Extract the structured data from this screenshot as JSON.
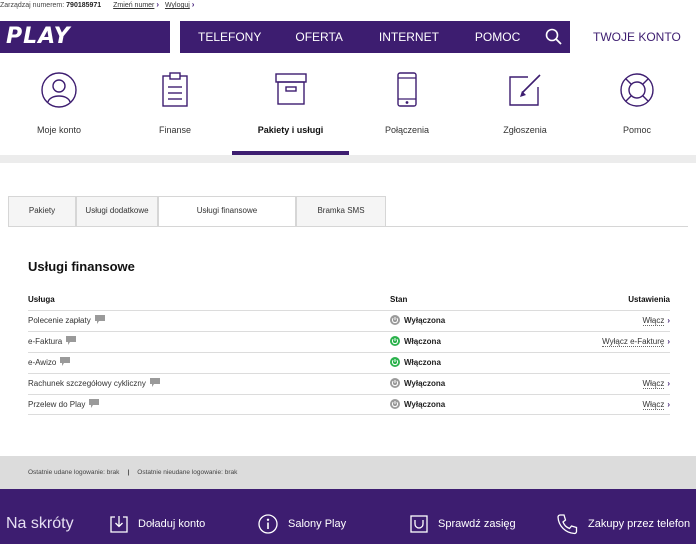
{
  "topbar": {
    "managing_label": "Zarządzaj numerem:",
    "number": "790185971",
    "change_number": "Zmień numer",
    "logout": "Wyloguj"
  },
  "header": {
    "logo": "PLAY",
    "nav": [
      "TELEFONY",
      "OFERTA",
      "INTERNET",
      "POMOC"
    ],
    "search_icon": "search-icon",
    "account_tab": "TWOJE KONTO"
  },
  "iconstrip": {
    "items": [
      {
        "label": "Moje konto",
        "icon": "user-icon",
        "active": false
      },
      {
        "label": "Finanse",
        "icon": "clipboard-icon",
        "active": false
      },
      {
        "label": "Pakiety i usługi",
        "icon": "box-icon",
        "active": true
      },
      {
        "label": "Połączenia",
        "icon": "phone-icon",
        "active": false
      },
      {
        "label": "Zgłoszenia",
        "icon": "edit-icon",
        "active": false
      },
      {
        "label": "Pomoc",
        "icon": "lifebuoy-icon",
        "active": false
      }
    ]
  },
  "tabs": [
    {
      "label": "Pakiety",
      "active": false
    },
    {
      "label": "Usługi dodatkowe",
      "active": false
    },
    {
      "label": "Usługi finansowe",
      "active": true
    },
    {
      "label": "Bramka SMS",
      "active": false
    }
  ],
  "section": {
    "title": "Usługi finansowe",
    "columns": {
      "service": "Usługa",
      "state": "Stan",
      "settings": "Ustawienia"
    },
    "rows": [
      {
        "name": "Polecenie zapłaty",
        "state": "Wyłączona",
        "on": false,
        "action": "Włącz"
      },
      {
        "name": "e-Faktura",
        "state": "Włączona",
        "on": true,
        "action": "Wyłącz e-Fakturę"
      },
      {
        "name": "e-Awizo",
        "state": "Włączona",
        "on": true,
        "action": ""
      },
      {
        "name": "Rachunek szczegółowy cykliczny",
        "state": "Wyłączona",
        "on": false,
        "action": "Włącz"
      },
      {
        "name": "Przelew do Play",
        "state": "Wyłączona",
        "on": false,
        "action": "Włącz"
      }
    ]
  },
  "login": {
    "last_success": "Ostatnie udane logowanie: brak",
    "separator": "|",
    "last_fail": "Ostatnie nieudane logowanie: brak"
  },
  "footer": {
    "title": "Na skróty",
    "shortcuts": [
      {
        "label": "Doładuj konto",
        "icon": "topup-icon"
      },
      {
        "label": "Salony Play",
        "icon": "info-icon"
      },
      {
        "label": "Sprawdź zasięg",
        "icon": "signal-icon"
      },
      {
        "label": "Zakupy przez telefon",
        "icon": "phone-handset-icon"
      }
    ]
  },
  "colors": {
    "brand": "#3d1d70",
    "on": "#2bb24c",
    "off": "#9a9a9a"
  }
}
